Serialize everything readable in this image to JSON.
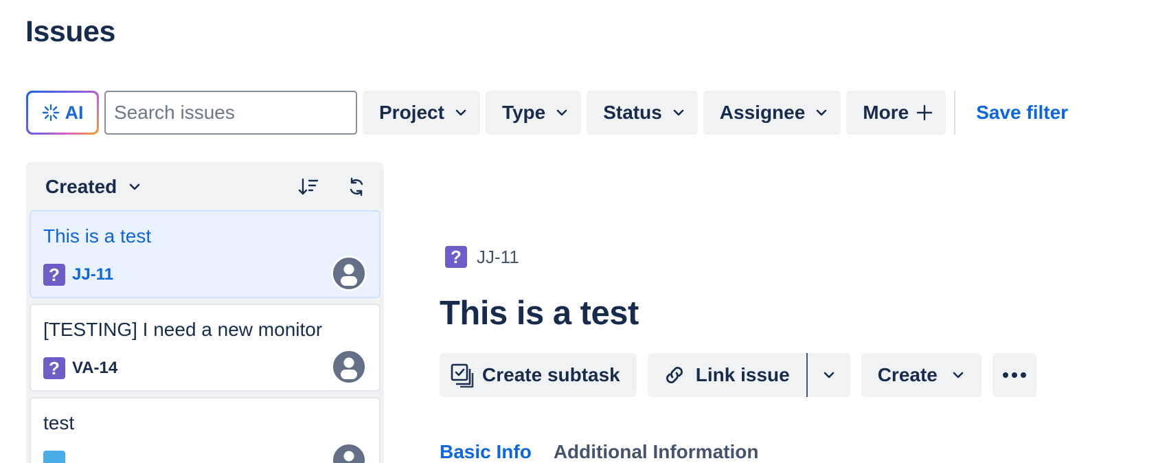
{
  "page": {
    "title": "Issues"
  },
  "filters": {
    "ai_label": "AI",
    "search_placeholder": "Search issues",
    "project_label": "Project",
    "type_label": "Type",
    "status_label": "Status",
    "assignee_label": "Assignee",
    "more_label": "More",
    "save_filter_label": "Save filter"
  },
  "list": {
    "sort_label": "Created",
    "items": [
      {
        "title": "This is a test",
        "key": "JJ-11",
        "icon": "question-icon",
        "selected": true
      },
      {
        "title": "[TESTING] I need a new monitor",
        "key": "VA-14",
        "icon": "question-icon",
        "selected": false
      },
      {
        "title": "test",
        "key": "",
        "icon": "task-icon",
        "selected": false
      }
    ]
  },
  "detail": {
    "key": "JJ-11",
    "title": "This is a test",
    "actions": {
      "create_subtask": "Create subtask",
      "link_issue": "Link issue",
      "create": "Create"
    },
    "tabs": {
      "basic_info": "Basic Info",
      "additional_information": "Additional Information"
    }
  },
  "colors": {
    "accent": "#0c66e4",
    "text": "#172b4d",
    "chip_bg": "#f1f2f4",
    "selected_bg": "#e9f2fe",
    "question_icon": "#6e5dc6"
  }
}
